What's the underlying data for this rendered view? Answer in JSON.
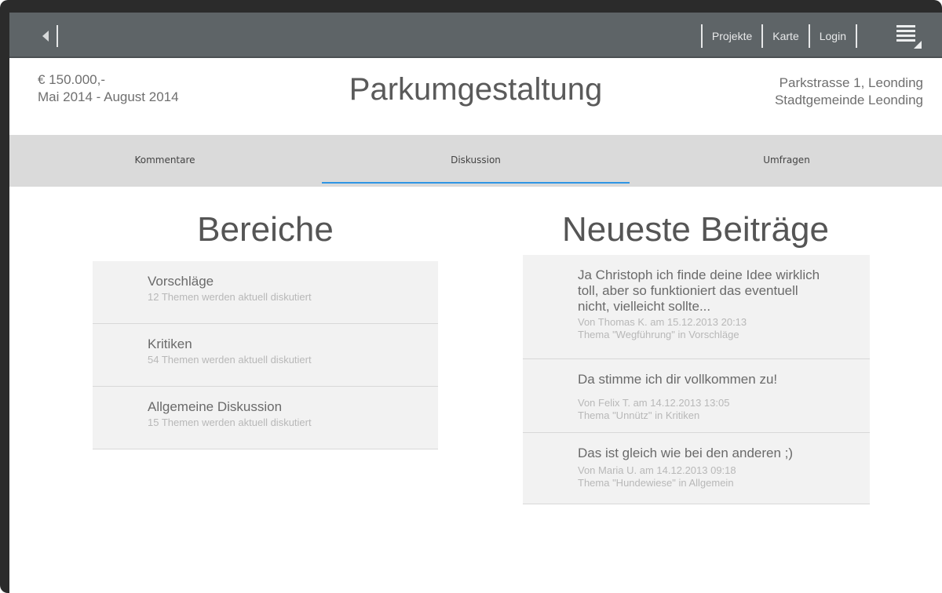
{
  "nav": {
    "items": [
      "Projekte",
      "Karte",
      "Login"
    ]
  },
  "project": {
    "budget": "€ 150.000,-",
    "dates": "Mai 2014 - August 2014",
    "title": "Parkumgestaltung",
    "address_line1": "Parkstrasse 1, Leonding",
    "address_line2": "Stadtgemeinde Leonding"
  },
  "tabs": [
    {
      "label": "Kommentare",
      "active": false
    },
    {
      "label": "Diskussion",
      "active": true
    },
    {
      "label": "Umfragen",
      "active": false
    }
  ],
  "areas": {
    "heading": "Bereiche",
    "items": [
      {
        "title": "Vorschläge",
        "subtitle": "12 Themen werden aktuell diskutiert"
      },
      {
        "title": "Kritiken",
        "subtitle": "54 Themen werden aktuell diskutiert"
      },
      {
        "title": "Allgemeine Diskussion",
        "subtitle": "15 Themen werden aktuell diskutiert"
      }
    ]
  },
  "posts": {
    "heading": "Neueste Beiträge",
    "items": [
      {
        "text": "Ja Christoph ich finde deine Idee wirklich toll, aber so funktioniert das eventuell nicht, vielleicht sollte...",
        "meta": "Von Thomas K. am 15.12.2013 20:13",
        "topic": "Thema \"Wegführung\" in Vorschläge"
      },
      {
        "text": "Da stimme ich dir vollkommen zu!",
        "meta": "Von Felix T. am 14.12.2013 13:05",
        "topic": "Thema \"Unnütz\" in Kritiken"
      },
      {
        "text": "Das ist gleich wie bei den anderen ;)",
        "meta": "Von Maria U. am 14.12.2013 09:18",
        "topic": "Thema \"Hundewiese\" in Allgemein"
      }
    ]
  },
  "colors": {
    "topbar": "#5e6467",
    "tabs_bg": "#dadada",
    "accent": "#2f95e4"
  }
}
